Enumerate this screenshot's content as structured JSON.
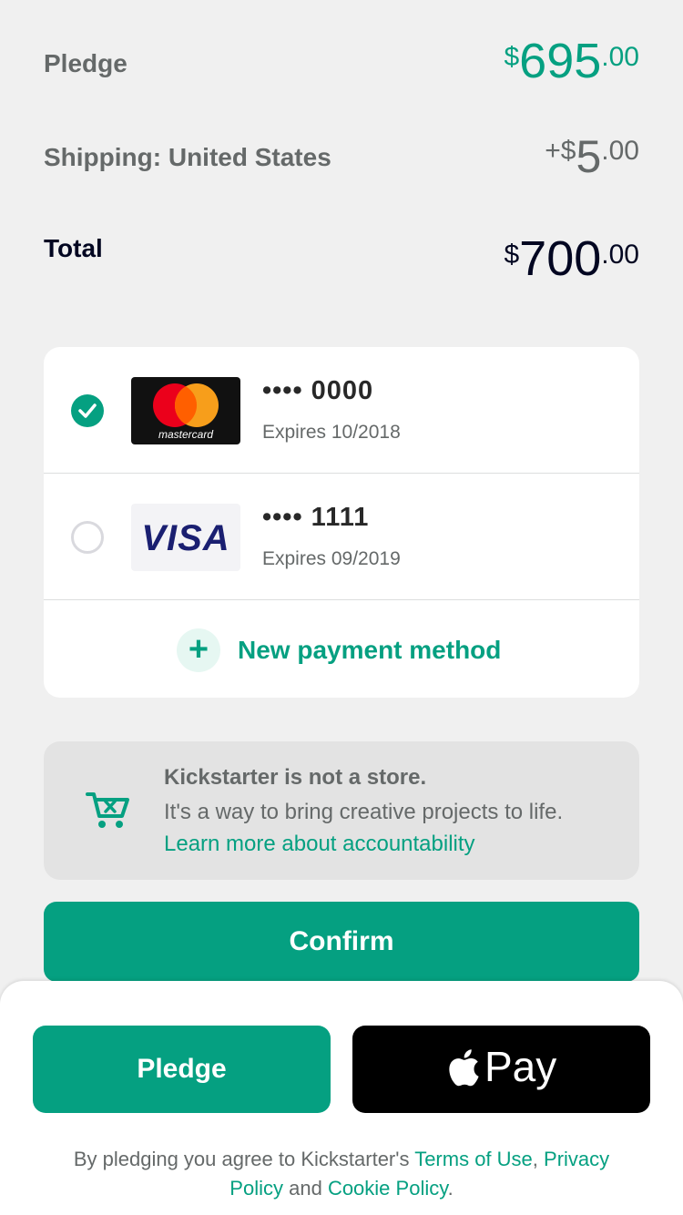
{
  "summary": {
    "pledge": {
      "label": "Pledge",
      "prefix": "",
      "symbol": "$",
      "whole": "695",
      "cents": ".00"
    },
    "shipping": {
      "label": "Shipping: United States",
      "prefix": "+",
      "symbol": "$",
      "whole": "5",
      "cents": ".00"
    },
    "total": {
      "label": "Total",
      "prefix": "",
      "symbol": "$",
      "whole": "700",
      "cents": ".00"
    }
  },
  "payment_methods": [
    {
      "brand_text": "mastercard",
      "number": "•••• 0000",
      "expiry": "Expires 10/2018",
      "selected": true
    },
    {
      "brand_text": "VISA",
      "number": "•••• 1111",
      "expiry": "Expires 09/2019",
      "selected": false
    }
  ],
  "new_payment": {
    "plus": "+",
    "label": "New payment method"
  },
  "not_a_store": {
    "title": "Kickstarter is not a store.",
    "text": "It's a way to bring creative projects to life.",
    "link": "Learn more about accountability"
  },
  "confirm_label": "Confirm",
  "sheet": {
    "pledge_label": "Pledge",
    "apple_pay_label": "Pay",
    "legal_prefix": "By pledging you agree to Kickstarter's",
    "terms": "Terms of Use",
    "comma": ",",
    "privacy": "Privacy Policy",
    "and": "and",
    "cookie": "Cookie Policy",
    "period": "."
  },
  "colors": {
    "brand_green": "#05a081",
    "text_gray": "#656969",
    "text_dark": "#020621",
    "background": "#f0f0f0"
  }
}
